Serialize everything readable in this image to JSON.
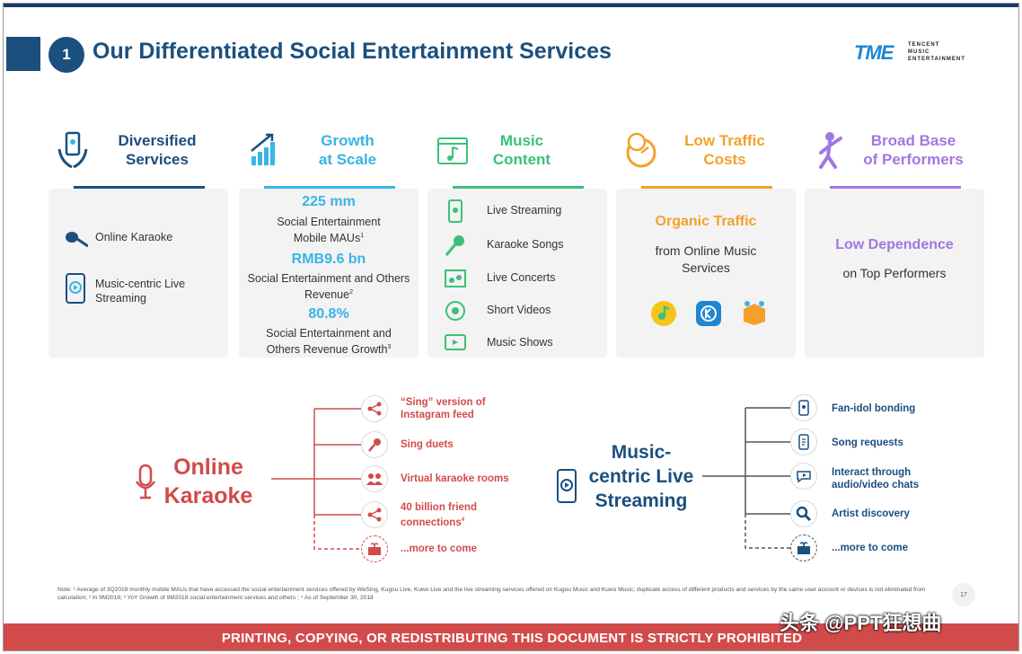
{
  "slide": {
    "number": "1",
    "title": "Our Differentiated Social Entertainment Services",
    "logo": {
      "mark": "TME",
      "line1": "TENCENT",
      "line2": "MUSIC",
      "line3": "ENTERTAINMENT"
    }
  },
  "colors": {
    "navy": "#1b4f7e",
    "blue": "#39b4e6",
    "green": "#3cc07a",
    "orange": "#f3a12b",
    "purple": "#a178e0",
    "red": "#d24b4b"
  },
  "columns": [
    {
      "label_1": "Diversified",
      "label_2": "Services",
      "icon": "hands-phone-icon"
    },
    {
      "label_1": "Growth",
      "label_2": "at Scale",
      "icon": "growth-chart-icon"
    },
    {
      "label_1": "Music",
      "label_2": "Content",
      "icon": "music-note-icon"
    },
    {
      "label_1": "Low Traffic",
      "label_2": "Costs",
      "icon": "coin-stopwatch-icon"
    },
    {
      "label_1": "Broad Base",
      "label_2": "of Performers",
      "icon": "performer-icon"
    }
  ],
  "diversified": {
    "items": [
      {
        "label": "Online Karaoke",
        "icon": "microphone-icon"
      },
      {
        "label_1": "Music-centric Live",
        "label_2": "Streaming",
        "icon": "phone-play-icon"
      }
    ]
  },
  "growth": {
    "stat1_value": "225 mm",
    "stat1_line1": "Social Entertainment",
    "stat1_line2": "Mobile MAUs",
    "stat1_sup": "1",
    "stat2_value": "RMB9.6 bn",
    "stat2_line1": "Social Entertainment and Others",
    "stat2_line2": "Revenue",
    "stat2_sup": "2",
    "stat3_value": "80.8%",
    "stat3_line1": "Social Entertainment and",
    "stat3_line2": "Others Revenue Growth",
    "stat3_sup": "3"
  },
  "music_content": {
    "items": [
      {
        "label": "Live Streaming",
        "icon": "phone-icon"
      },
      {
        "label": "Karaoke Songs",
        "icon": "microphone-icon"
      },
      {
        "label": "Live Concerts",
        "icon": "concert-icon"
      },
      {
        "label": "Short Videos",
        "icon": "video-icon"
      },
      {
        "label": "Music Shows",
        "icon": "tv-icon"
      }
    ]
  },
  "traffic": {
    "headline": "Organic Traffic",
    "line1": "from Online Music",
    "line2": "Services",
    "apps": [
      "qq-music-icon",
      "kugou-icon",
      "kuwo-icon"
    ]
  },
  "performers": {
    "headline": "Low Dependence",
    "line1": "on Top Performers"
  },
  "karaoke_tree": {
    "title_1": "Online",
    "title_2": "Karaoke",
    "branches": [
      {
        "line1": "“Sing” version of",
        "line2": "Instagram feed",
        "icon": "share-icon"
      },
      {
        "line1": "Sing duets",
        "line2": "",
        "icon": "microphone-icon"
      },
      {
        "line1": "Virtual karaoke rooms",
        "line2": "",
        "icon": "people-icon"
      },
      {
        "line1": "40 billion friend",
        "line2": "connections",
        "sup": "4",
        "icon": "share-icon"
      },
      {
        "line1": "...more to come",
        "line2": "",
        "icon": "gift-icon"
      }
    ]
  },
  "streaming_tree": {
    "title_1": "Music-",
    "title_2": "centric Live",
    "title_3": "Streaming",
    "branches": [
      {
        "line1": "Fan-idol bonding",
        "line2": "",
        "icon": "phone-icon"
      },
      {
        "line1": "Song requests",
        "line2": "",
        "icon": "request-icon"
      },
      {
        "line1": "Interact through",
        "line2": "audio/video chats",
        "icon": "chat-icon"
      },
      {
        "line1": "Artist discovery",
        "line2": "",
        "icon": "search-icon"
      },
      {
        "line1": "...more to come",
        "line2": "",
        "icon": "gift-icon"
      }
    ]
  },
  "note": "Note: ¹ Average of 3Q2018 monthly mobile MAUs that have accessed the social entertainment services offered by WeSing, Kugou Live, Kuwo Live and the live streaming services offered on Kugou Music and Kuwo Music; duplicate access of different products and services by the same user account or devices is not eliminated from calculation; ² In 9M2018; ³ YoY Growth of 9M2018 social entertainment services and others ; ⁴ As of September 30, 2018",
  "page_number": "17",
  "footer": "PRINTING, COPYING, OR REDISTRIBUTING THIS DOCUMENT IS STRICTLY PROHIBITED",
  "watermark": "头条 @PPT狂想曲"
}
